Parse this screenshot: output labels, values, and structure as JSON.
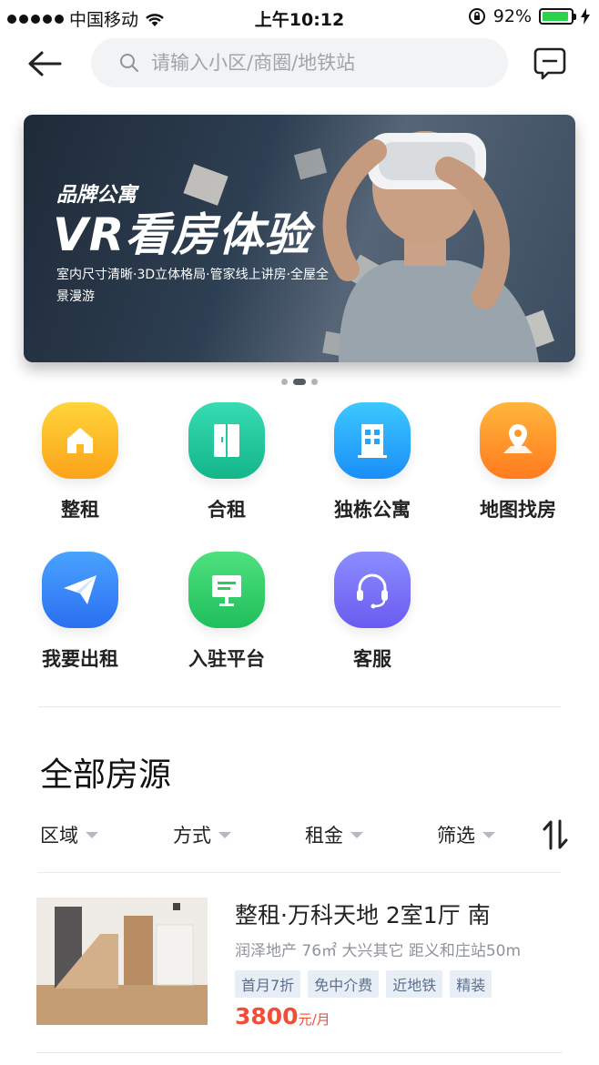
{
  "status_bar": {
    "carrier": "中国移动",
    "time": "上午10:12",
    "battery": "92%",
    "battery_level": 0.92
  },
  "search": {
    "placeholder": "请输入小区/商圈/地铁站"
  },
  "banner": {
    "subtitle": "品牌公寓",
    "title": "VR看房体验",
    "description": "室内尺寸清晰·3D立体格局·管家线上讲房·全屋全景漫游",
    "page_count": 3,
    "active_page": 2
  },
  "categories": [
    {
      "label": "整租",
      "icon": "house-icon",
      "color_from": "#ffd43a",
      "color_to": "#fba319"
    },
    {
      "label": "合租",
      "icon": "door-icon",
      "color_from": "#37dcb2",
      "color_to": "#14b58a"
    },
    {
      "label": "独栋公寓",
      "icon": "building-icon",
      "color_from": "#3cc8ff",
      "color_to": "#1a8ef7"
    },
    {
      "label": "地图找房",
      "icon": "map-pin-icon",
      "color_from": "#ffb53b",
      "color_to": "#ff7b1f"
    },
    {
      "label": "我要出租",
      "icon": "paper-plane-icon",
      "color_from": "#4aa3ff",
      "color_to": "#2a6ff0"
    },
    {
      "label": "入驻平台",
      "icon": "billboard-icon",
      "color_from": "#4fe07f",
      "color_to": "#1fbf5b"
    },
    {
      "label": "客服",
      "icon": "headset-icon",
      "color_from": "#8c8dff",
      "color_to": "#6a5bf0"
    }
  ],
  "section": {
    "title": "全部房源"
  },
  "filters": [
    {
      "label": "区域"
    },
    {
      "label": "方式"
    },
    {
      "label": "租金"
    },
    {
      "label": "筛选"
    }
  ],
  "listing": {
    "title": "整租·万科天地 2室1厅 南",
    "meta": "润泽地产  76㎡ 大兴其它 距义和庄站50m",
    "tags": [
      "首月7折",
      "免中介费",
      "近地铁",
      "精装"
    ],
    "price": "3800",
    "price_unit": "元/月"
  }
}
